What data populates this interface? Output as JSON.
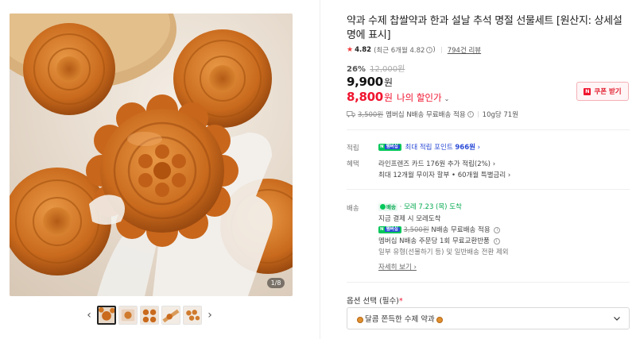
{
  "gallery": {
    "counter": "1/8",
    "thumbnail_count": 5,
    "prev_glyph": "‹",
    "next_glyph": "›"
  },
  "product": {
    "title": "약과 수제 찹쌀약과 한과 설날 추석 명절 선물세트 [원산지: 상세설명에 표시]",
    "rating": {
      "star_glyph": "★",
      "score": "4.82",
      "recent_text": "(최근 6개월 4.82",
      "recent_close": ")",
      "info_glyph": "i",
      "review_link": "794건 리뷰"
    },
    "discount": {
      "rate": "26%",
      "original_price": "12,000원"
    },
    "price": {
      "amount": "9,900",
      "unit": "원"
    },
    "my_price": {
      "amount": "8,800",
      "unit": "원",
      "label": "나의 할인가",
      "chevron": "⌄"
    },
    "coupon": {
      "badge": "N",
      "label": "쿠폰 받기"
    },
    "shipping": {
      "original_fee": "3,500원",
      "text": "멤버십 N배송 무료배송 적용",
      "info_glyph": "i",
      "unit_price": "10g당 71원"
    }
  },
  "benefits": {
    "points_label": "적립",
    "points_badge": "N",
    "points_badge_member": "멤버십",
    "points_text": "최대 적립 포인트",
    "points_value": "966원",
    "points_chevron": "›",
    "perks_label": "혜택",
    "perk_1": "라인프렌즈 카드 176원 추가 적립(2%) ›",
    "perk_2": "최대 12개월 무이자 할부 • 60개월 특별금리 ›"
  },
  "delivery": {
    "label": "배송",
    "badge_text": "배송",
    "eta_sep": "·",
    "eta": "모레 7.23 (목) 도착",
    "order_note": "지금 결제 시 모레도착",
    "member_badge": "N",
    "member_badge_member": "멤버십",
    "free_original": "3,500원",
    "free_text": "N배송 무료배송 적용",
    "return_text": "멤버십 N배송 주문당 1회 무료교환반품",
    "info_glyph": "i",
    "exception_note": "일부 유형(선물하기 등) 및 일반배송 전환 제외",
    "details_link": "자세히 보기 ›"
  },
  "options": {
    "label": "옵션 선택 (필수)",
    "required_mark": "*",
    "selected_value": "달콤 쫀득한 수제 약과"
  },
  "colors": {
    "accent_red": "#f0142f",
    "naver_green": "#03c75a",
    "link_blue": "#2b4bd6",
    "yakgwa_orange": "#d9772a"
  }
}
